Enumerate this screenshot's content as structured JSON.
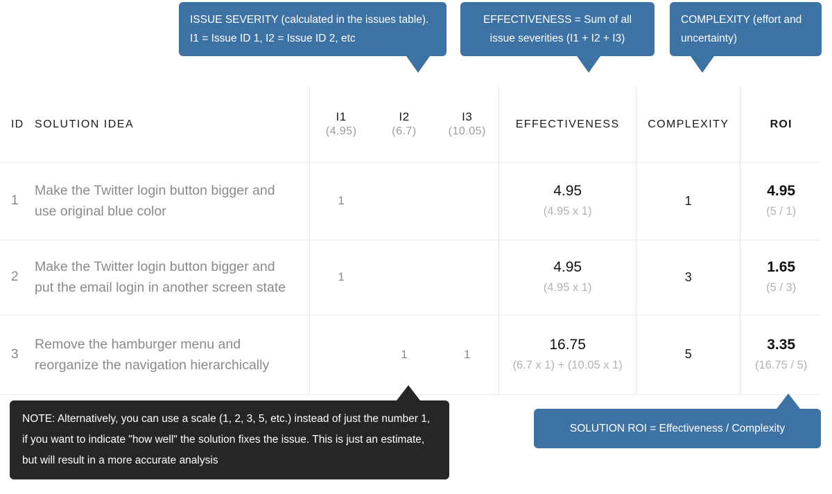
{
  "callouts": {
    "severity": "ISSUE SEVERITY (calculated in the issues table). I1 = Issue ID 1, I2 = Issue ID 2, etc",
    "effectiveness": "EFFECTIVENESS = Sum of all issue severities (I1 + I2 + I3)",
    "complexity": "COMPLEXITY (effort and uncertainty)",
    "note": "NOTE: Alternatively, you can use a scale (1, 2, 3, 5, etc.) instead of just the number 1, if you want to indicate \"how well\" the solution fixes the issue. This is just an estimate, but will result in a more accurate analysis",
    "roi": "SOLUTION ROI = Effectiveness / Complexity"
  },
  "colors": {
    "callout_blue": "#3d72a4",
    "callout_dark": "#262626",
    "text_primary": "#111111",
    "text_muted": "#8a8a8a",
    "text_faint": "#b3b3b3",
    "border": "#ededed"
  },
  "table": {
    "headers": {
      "id": "ID",
      "idea": "SOLUTION IDEA",
      "i1": "I1",
      "i1_sub": "(4.95)",
      "i2": "I2",
      "i2_sub": "(6.7)",
      "i3": "I3",
      "i3_sub": "(10.05)",
      "effectiveness": "EFFECTIVENESS",
      "complexity": "COMPLEXITY",
      "roi": "ROI"
    },
    "rows": [
      {
        "id": "1",
        "idea": "Make the Twitter login button bigger and use original blue color",
        "i1": "1",
        "i2": "",
        "i3": "",
        "effectiveness": "4.95",
        "effectiveness_formula": "(4.95 x 1)",
        "complexity": "1",
        "roi": "4.95",
        "roi_formula": "(5 / 1)"
      },
      {
        "id": "2",
        "idea": "Make the Twitter login button bigger and put the email login in another screen state",
        "i1": "1",
        "i2": "",
        "i3": "",
        "effectiveness": "4.95",
        "effectiveness_formula": "(4.95 x 1)",
        "complexity": "3",
        "roi": "1.65",
        "roi_formula": "(5 / 3)"
      },
      {
        "id": "3",
        "idea": "Remove the hamburger menu and reorganize the navigation hierarchically",
        "i1": "",
        "i2": "1",
        "i3": "1",
        "effectiveness": "16.75",
        "effectiveness_formula": "(6.7 x 1) + (10.05 x 1)",
        "complexity": "5",
        "roi": "3.35",
        "roi_formula": "(16.75 / 5)"
      }
    ]
  }
}
